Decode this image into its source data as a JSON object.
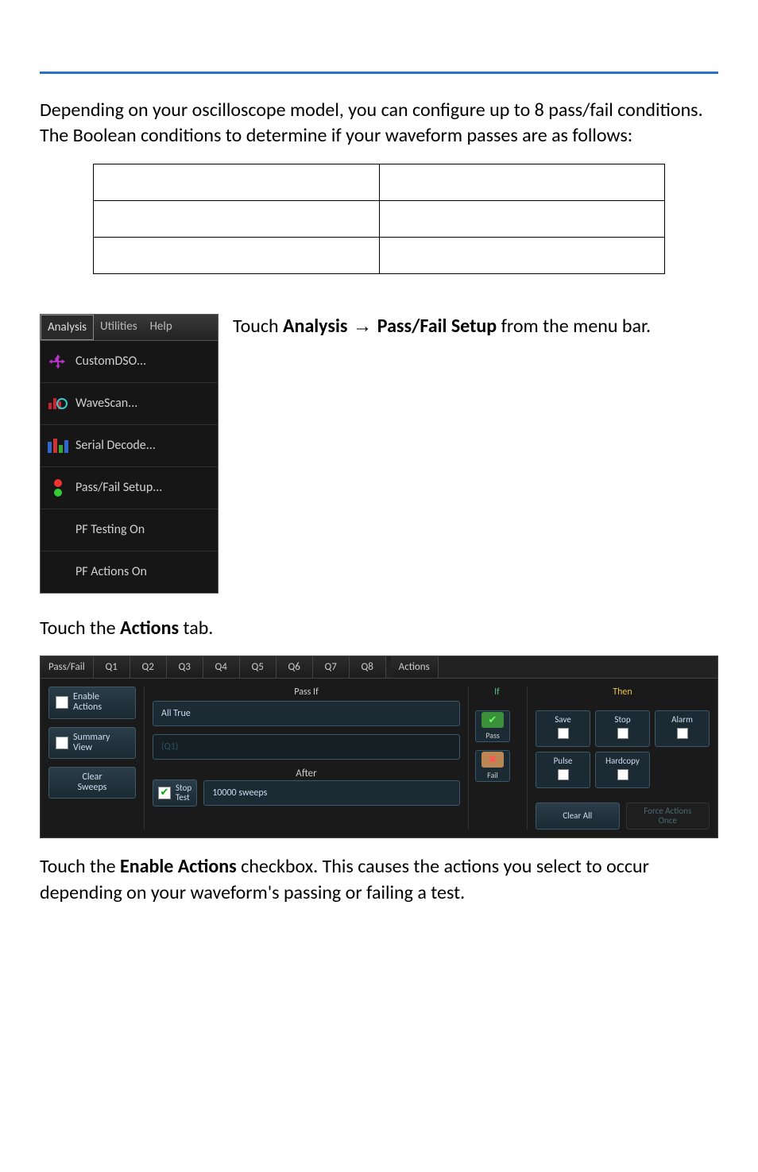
{
  "intro": "Depending on your oscilloscope model, you can configure up to 8 pass/fail conditions. The Boolean conditions to determine if your waveform passes are as follows:",
  "menu": {
    "titlebar": {
      "analysis": "Analysis",
      "utilities": "Utilities",
      "help": "Help"
    },
    "items": {
      "customdso": "CustomDSO...",
      "wavescan": "WaveScan...",
      "serialdecode": "Serial Decode...",
      "passfailsetup": "Pass/Fail Setup...",
      "pftestingon": "PF Testing On",
      "pfactionson": "PF Actions On"
    }
  },
  "caption1_pre": "Touch ",
  "caption1_b1": "Analysis",
  "caption1_arrow": " → ",
  "caption1_b2": "Pass/Fail Setup",
  "caption1_post": " from the menu bar.",
  "caption2_pre": "Touch the ",
  "caption2_b": "Actions",
  "caption2_post": " tab.",
  "pf": {
    "tabs": {
      "passfail": "Pass/Fail",
      "q1": "Q1",
      "q2": "Q2",
      "q3": "Q3",
      "q4": "Q4",
      "q5": "Q5",
      "q6": "Q6",
      "q7": "Q7",
      "q8": "Q8",
      "actions": "Actions"
    },
    "left": {
      "enable_actions": "Enable\nActions",
      "summary_view": "Summary\nView",
      "clear_sweeps": "Clear\nSweeps"
    },
    "mid": {
      "passif": "Pass If",
      "all_true": "All True",
      "q1_dim": "(Q1)",
      "after": "After",
      "stop_test": "Stop\nTest",
      "sweeps_field": "10000 sweeps"
    },
    "ifcol": {
      "if": "If",
      "pass": "Pass",
      "fail": "Fail"
    },
    "then": {
      "then": "Then",
      "save": "Save",
      "stop": "Stop",
      "alarm": "Alarm",
      "pulse": "Pulse",
      "hardcopy": "Hardcopy",
      "clear_all": "Clear All",
      "force_actions_once": "Force Actions\nOnce"
    }
  },
  "closing_pre": "Touch the ",
  "closing_b": "Enable Actions",
  "closing_post": " checkbox. This causes the actions you select to occur depending on your waveform's passing or failing a test."
}
